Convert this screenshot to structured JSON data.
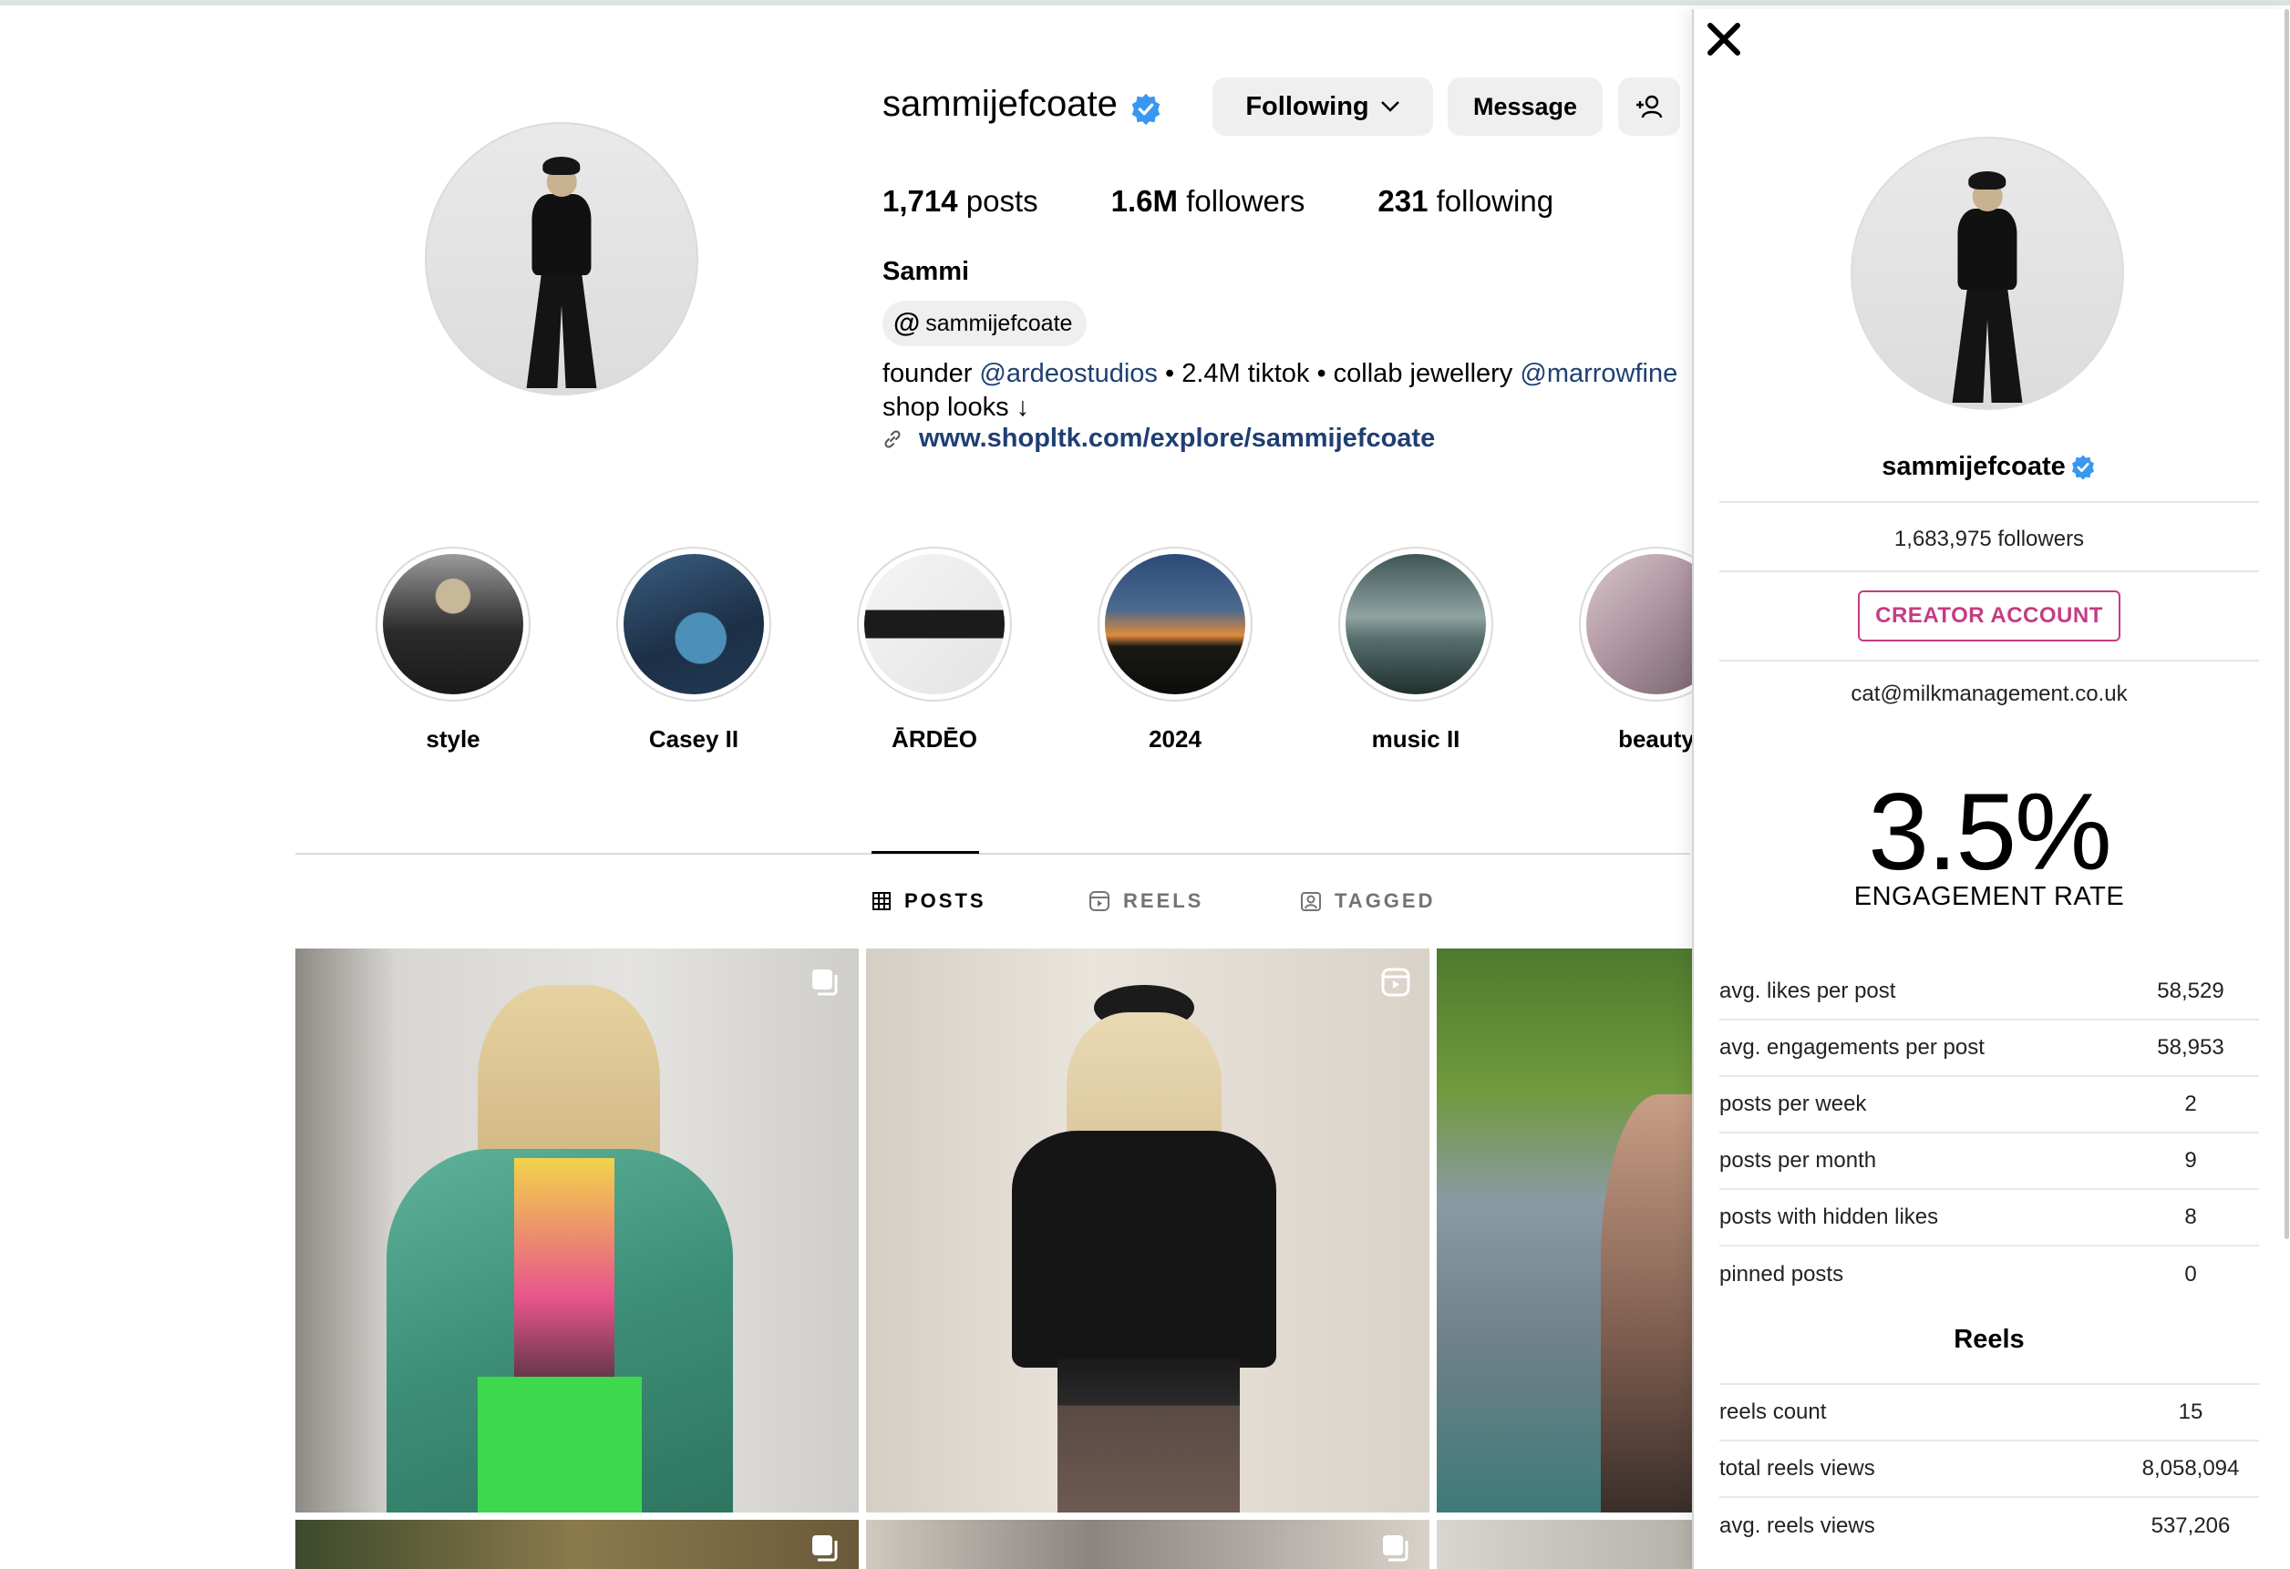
{
  "profile": {
    "username": "sammijefcoate",
    "buttons": {
      "following": "Following",
      "message": "Message"
    },
    "stats": {
      "posts_count": "1,714",
      "posts_label": "posts",
      "followers_count": "1.6M",
      "followers_label": "followers",
      "following_count": "231",
      "following_label": "following"
    },
    "full_name": "Sammi",
    "threads_handle": "sammijefcoate",
    "bio": {
      "founder": "founder ",
      "mention1": "@ardeostudios",
      "mid": " • 2.4M tiktok • collab jewellery ",
      "mention2": "@marrowfine",
      "line2": "shop looks ↓"
    },
    "link": "www.shopltk.com/explore/sammijefcoate"
  },
  "highlights": [
    {
      "label": "style"
    },
    {
      "label": "Casey II"
    },
    {
      "label": "ĀRDĒO"
    },
    {
      "label": "2024"
    },
    {
      "label": "music II"
    },
    {
      "label": "beauty"
    }
  ],
  "tabs": [
    {
      "label": "POSTS",
      "active": true
    },
    {
      "label": "REELS",
      "active": false
    },
    {
      "label": "TAGGED",
      "active": false
    }
  ],
  "icons": {
    "verified": "verified-badge-icon",
    "close": "close-icon",
    "add_user": "add-user-icon",
    "chevron": "chevron-down-icon",
    "threads": "threads-icon",
    "link": "link-icon",
    "grid": "grid-icon",
    "reels": "reels-icon",
    "tagged": "tagged-icon",
    "carousel": "carousel-icon"
  },
  "colors": {
    "accent_blue": "#3897f0",
    "link_blue": "#1f3f73",
    "creator_pink": "#c63c83"
  },
  "panel": {
    "username": "sammijefcoate",
    "followers": "1,683,975 followers",
    "account_type": "CREATOR ACCOUNT",
    "email": "cat@milkmanagement.co.uk",
    "engagement_rate": "3.5%",
    "engagement_label": "ENGAGEMENT RATE",
    "metrics": [
      {
        "label": "avg. likes per post",
        "value": "58,529"
      },
      {
        "label": "avg. engagements per post",
        "value": "58,953"
      },
      {
        "label": "posts per week",
        "value": "2"
      },
      {
        "label": "posts per month",
        "value": "9"
      },
      {
        "label": "posts with hidden likes",
        "value": "8"
      },
      {
        "label": "pinned posts",
        "value": "0"
      }
    ],
    "reels_title": "Reels",
    "reels_metrics": [
      {
        "label": "reels count",
        "value": "15"
      },
      {
        "label": "total reels views",
        "value": "8,058,094"
      },
      {
        "label": "avg. reels views",
        "value": "537,206"
      }
    ]
  }
}
